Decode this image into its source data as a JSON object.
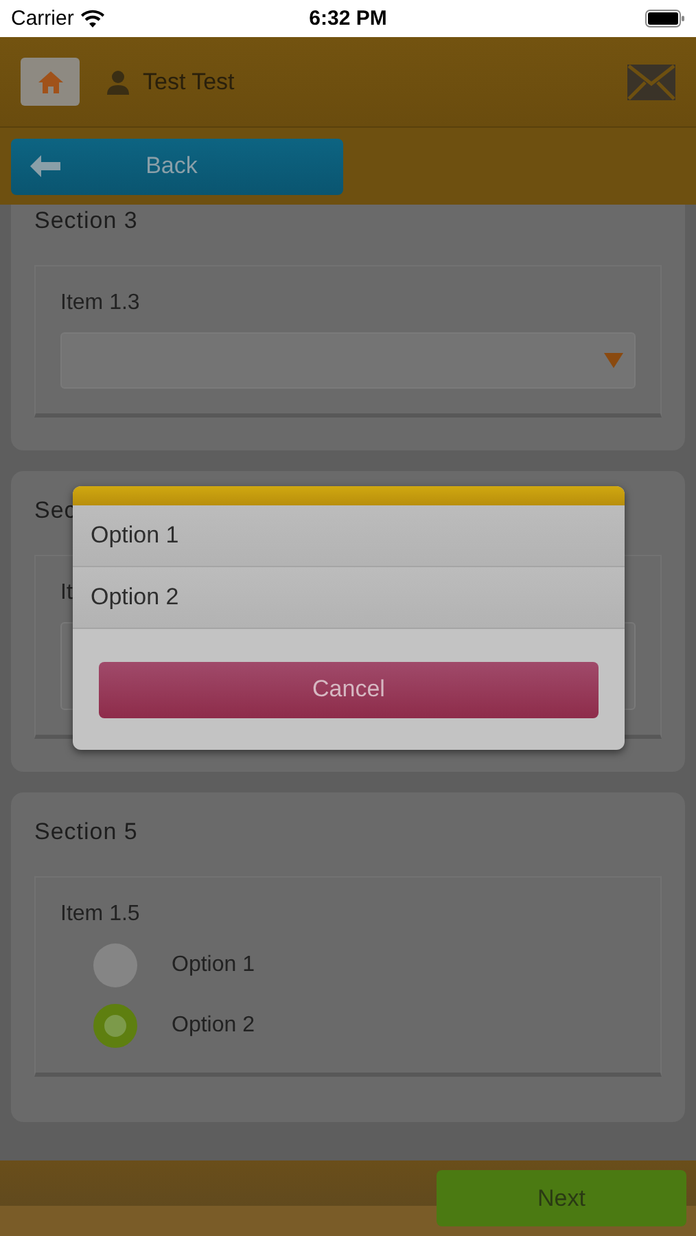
{
  "status_bar": {
    "carrier": "Carrier",
    "time": "6:32 PM"
  },
  "header": {
    "user": "Test Test"
  },
  "back_button": "Back",
  "sections": [
    {
      "title": "Section 3",
      "item": {
        "kind": "select",
        "label": "Item 1.3"
      }
    },
    {
      "title": "Sec",
      "item": {
        "kind": "input",
        "label": "It"
      }
    },
    {
      "title": "Section 5",
      "item": {
        "kind": "radio",
        "label": "Item 1.5",
        "options": [
          {
            "label": "Option 1",
            "selected": false
          },
          {
            "label": "Option 2",
            "selected": true
          }
        ]
      }
    }
  ],
  "dialog": {
    "options": [
      "Option 1",
      "Option 2"
    ],
    "cancel": "Cancel"
  },
  "footer": {
    "next": "Next"
  }
}
